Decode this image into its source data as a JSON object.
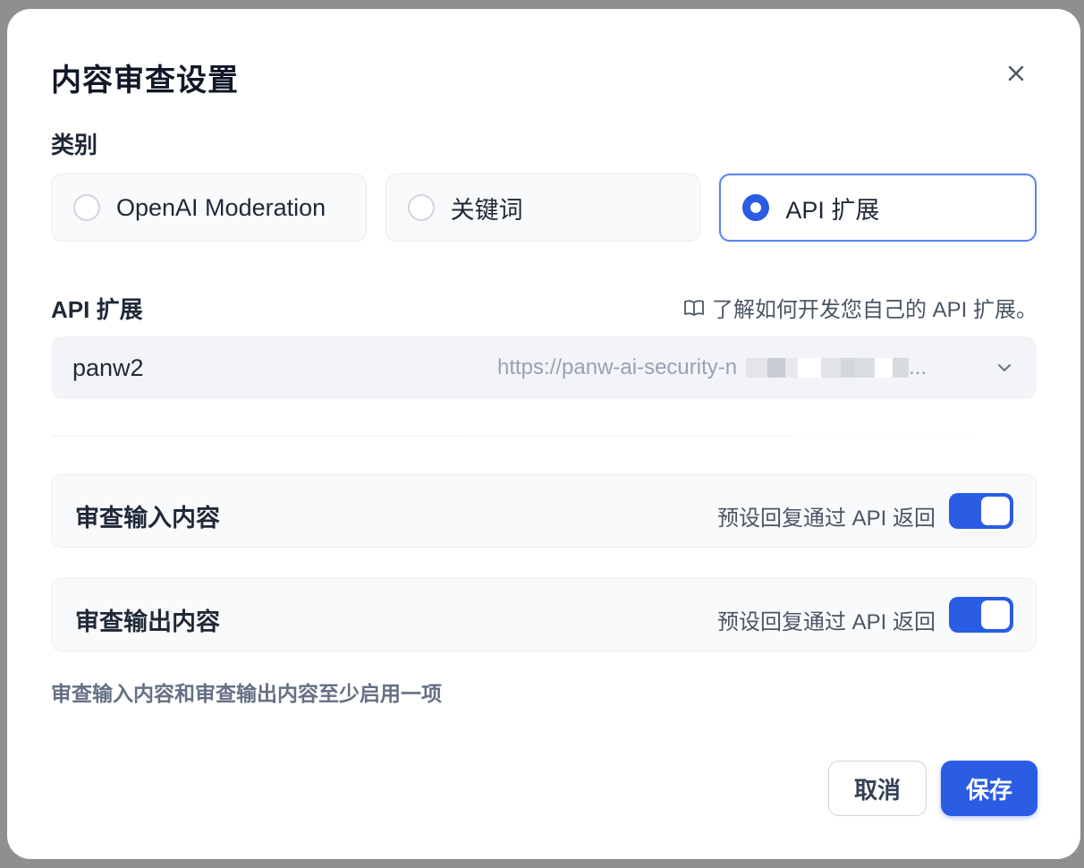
{
  "dialog": {
    "title": "内容审查设置",
    "close_icon": "close-icon"
  },
  "category": {
    "label": "类别",
    "options": [
      {
        "label": "OpenAI Moderation",
        "selected": false
      },
      {
        "label": "关键词",
        "selected": false
      },
      {
        "label": "API 扩展",
        "selected": true
      }
    ]
  },
  "api_extension": {
    "label": "API 扩展",
    "docs_link": "了解如何开发您自己的 API 扩展。",
    "docs_icon": "book-icon",
    "selected_name": "panw2",
    "selected_url": "https://panw-ai-security-n",
    "url_suffix": "..."
  },
  "moderation": {
    "input": {
      "title": "审查输入内容",
      "hint": "预设回复通过 API 返回",
      "enabled": true
    },
    "output": {
      "title": "审查输出内容",
      "hint": "预设回复通过 API 返回",
      "enabled": true
    },
    "note": "审查输入内容和审查输出内容至少启用一项"
  },
  "footer": {
    "cancel_label": "取消",
    "save_label": "保存"
  },
  "colors": {
    "accent": "#2a5ce4",
    "selected_border": "#5b84f1"
  }
}
